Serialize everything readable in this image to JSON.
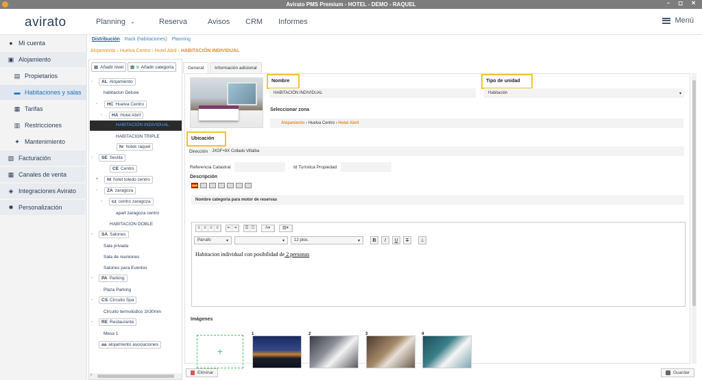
{
  "window": {
    "title": "Avirato PMS Premium - HOTEL - DEMO - RAQUEL"
  },
  "logo": "avirato",
  "topnav": {
    "planning": "Planning",
    "reserva": "Reserva",
    "avisos": "Avisos",
    "crm": "CRM",
    "informes": "Informes",
    "menu": "Menú"
  },
  "sidebar": {
    "mi_cuenta": "Mi cuenta",
    "alojamiento": "Alojamiento",
    "propietarios": "Propietarios",
    "habitaciones": "Habitaciones y salas",
    "tarifas": "Tarifas",
    "restricciones": "Restricciones",
    "mantenimiento": "Mantenimiento",
    "facturacion": "Facturación",
    "canales": "Canales de venta",
    "integraciones": "Integraciones Avirato",
    "personalizacion": "Personalización"
  },
  "subtabs": {
    "distribucion": "Distribución",
    "rack": "Rack (habitaciones)",
    "planning": "Planning"
  },
  "breadcrumb": {
    "b1": "Alojamiento",
    "b2": "Huelva Centro",
    "b3": "Hotel Abril",
    "b4": "HABITACIÓN INDIVIDUAL"
  },
  "tree": {
    "add_level": "Añadir nivel",
    "add_category": "Añadir categoría",
    "nodes": {
      "al_code": "AL",
      "al_name": "Alojamiento",
      "hab_deluxe": "habitacion Deluxe",
      "hc_code": "HC",
      "hc_name": "Huelva Centro",
      "ha_code": "HA",
      "ha_name": "Hotel Abril",
      "hab_individual": "HABITACIÓN INDIVIDUAL",
      "hab_triple": "HABITACION TRIPLE",
      "hr_code": "hr",
      "hr_name": "hotek raquel",
      "se_code": "SE",
      "se_name": "Sevilla",
      "ce_code": "CE",
      "ce_name": "Centro",
      "ht_code": "ht",
      "ht_name": "hotel toledo centro",
      "za_code": "ZA",
      "za_name": "zaragoza",
      "cz_code": "cz",
      "cz_name": "centro zaragoza",
      "apart_zaragoza": "apart zaragoza centro",
      "hab_doble": "HABITACION DOBLE",
      "sa_code": "SA",
      "sa_name": "Salones",
      "sala_privada": "Sala privada",
      "sala_reuniones": "Sala de reuniones",
      "salones_eventos": "Salones para Eventos",
      "pa_code": "PA",
      "pa_name": "Parking",
      "plaza_parking": "Plaza Parking",
      "cs_code": "CS",
      "cs_name": "Circuito Spa",
      "circuito_termo": "Circuito termolúdico 1h30min",
      "re_code": "RE",
      "re_name": "Restaurante",
      "mesa1": "Mesa 1",
      "aa_code": "aa",
      "aa_name": "alojamiento asociaciones"
    }
  },
  "tabs": {
    "general": "General",
    "adicional": "Información adicional"
  },
  "form": {
    "nombre_label": "Nombre",
    "nombre_value": "HABITACIÓN INDIVIDUAL",
    "tipo_label": "Tipo de unidad",
    "tipo_value": "Habitación",
    "zona_label": "Seleccionar zona",
    "zona_b1": "Alojamiento",
    "zona_b2": "Huelva Centro",
    "zona_b3": "Hotel Abril",
    "ubicacion_label": "Ubicación",
    "direccion_label": "Dirección",
    "direccion_value": "JXGF+8X Collado Villalba",
    "ref_catastral_label": "Referencia Catastral",
    "id_turistica_label": "Id Turística Propiedad",
    "descripcion_label": "Descripción",
    "nombre_cat_label": "Nombre categoría para motor de reservas",
    "editor": {
      "format": "Párrafo",
      "font": "",
      "size": "12 ptos.",
      "text": "Habitacion individual con posibilidad de",
      "text_u": " 2 personas"
    },
    "imagenes_label": "Imágenes",
    "img_nums": [
      "1",
      "2",
      "3",
      "4"
    ]
  },
  "buttons": {
    "eliminar": "Eliminar",
    "guardar": "Guardar"
  }
}
